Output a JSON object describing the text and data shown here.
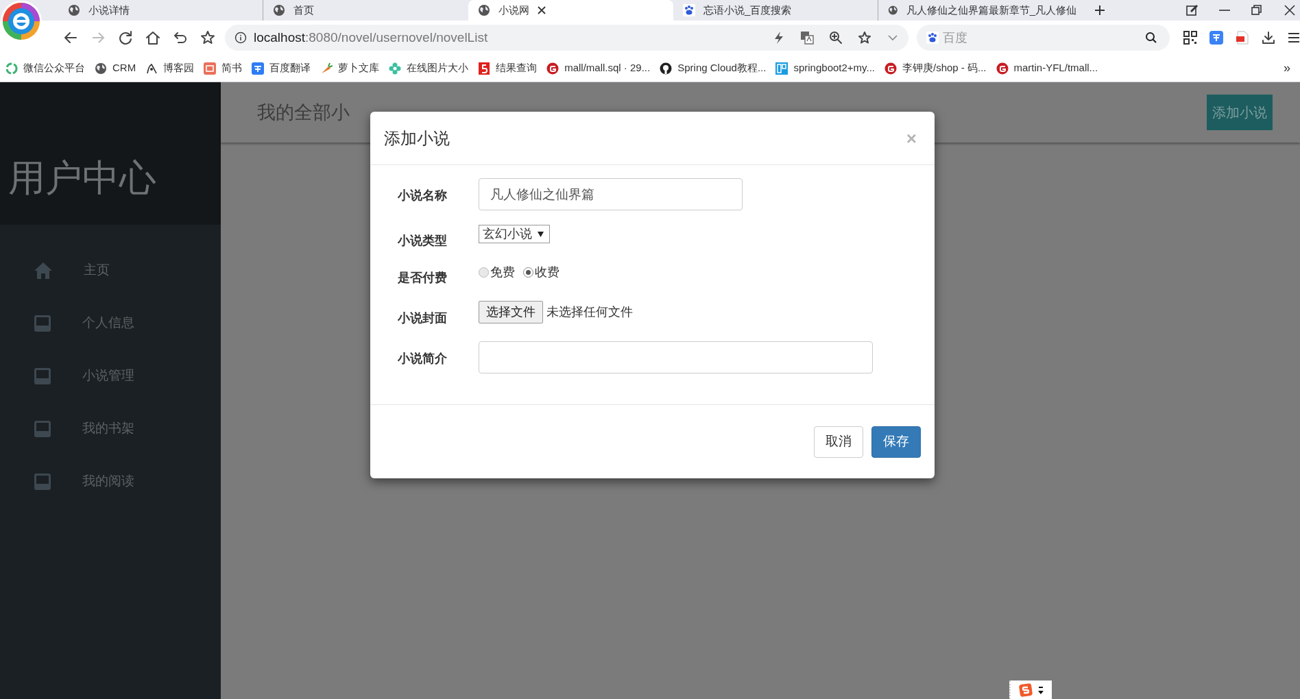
{
  "browser": {
    "tabs": [
      {
        "title": "小说详情",
        "selected": false
      },
      {
        "title": "首页",
        "selected": false
      },
      {
        "title": "小说网",
        "selected": true
      },
      {
        "title": "忘语小说_百度搜索",
        "selected": false
      },
      {
        "title": "凡人修仙之仙界篇最新章节_凡人修仙",
        "selected": false
      }
    ],
    "url_host": "localhost",
    "url_rest": ":8080/novel/usernovel/novelList",
    "search_placeholder": "百度",
    "bookmarks": [
      {
        "label": "微信公众平台"
      },
      {
        "label": "CRM"
      },
      {
        "label": "博客园"
      },
      {
        "label": "简书"
      },
      {
        "label": "百度翻译"
      },
      {
        "label": "萝卜文库"
      },
      {
        "label": "在线图片大小"
      },
      {
        "label": "结果查询"
      },
      {
        "label": "mall/mall.sql · 29..."
      },
      {
        "label": "Spring Cloud教程..."
      },
      {
        "label": "springboot2+my..."
      },
      {
        "label": "李钾庚/shop - 码..."
      },
      {
        "label": "martin-YFL/tmall..."
      }
    ],
    "more": "»"
  },
  "sidebar": {
    "title": "用户中心",
    "items": [
      {
        "label": "主页",
        "kind": "home"
      },
      {
        "label": "个人信息",
        "kind": "inbox"
      },
      {
        "label": "小说管理",
        "kind": "inbox"
      },
      {
        "label": "我的书架",
        "kind": "inbox"
      },
      {
        "label": "我的阅读",
        "kind": "inbox"
      }
    ]
  },
  "header": {
    "title": "我的全部小",
    "add_button": "添加小说"
  },
  "modal": {
    "title": "添加小说",
    "close": "×",
    "fields": [
      {
        "kind": "text",
        "label": "小说名称",
        "value": "凡人修仙之仙界篇"
      },
      {
        "kind": "select",
        "label": "小说类型",
        "value": "玄幻小说"
      },
      {
        "kind": "radio",
        "label": "是否付费",
        "options": [
          {
            "label": "免费",
            "selected": false
          },
          {
            "label": "收费",
            "selected": true
          }
        ]
      },
      {
        "kind": "file",
        "label": "小说封面",
        "button": "选择文件",
        "status": "未选择任何文件"
      },
      {
        "kind": "textarea",
        "label": "小说简介"
      }
    ],
    "buttons": [
      {
        "label": "取消",
        "kind": "default"
      },
      {
        "label": "保存",
        "kind": "primary"
      }
    ]
  }
}
